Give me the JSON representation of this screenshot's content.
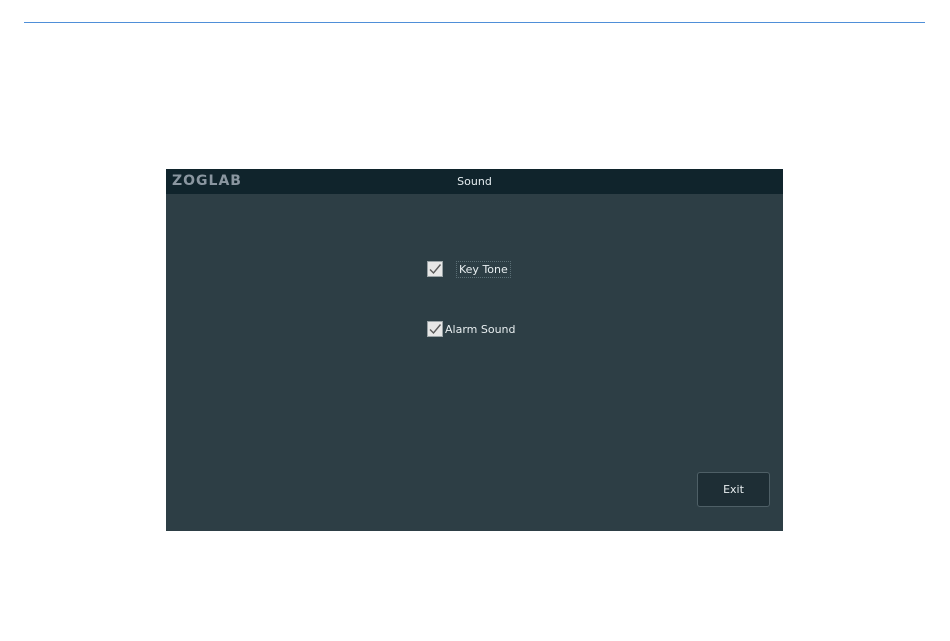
{
  "window": {
    "brand": "ZOGLAB",
    "title": "Sound"
  },
  "options": [
    {
      "label": "Key Tone",
      "checked": true
    },
    {
      "label": "Alarm Sound",
      "checked": true
    }
  ],
  "buttons": {
    "exit_label": "Exit"
  },
  "colors": {
    "panel_background": "#2d3e45",
    "titlebar_background": "#10242c",
    "accent_rule": "#4f8fd8"
  }
}
